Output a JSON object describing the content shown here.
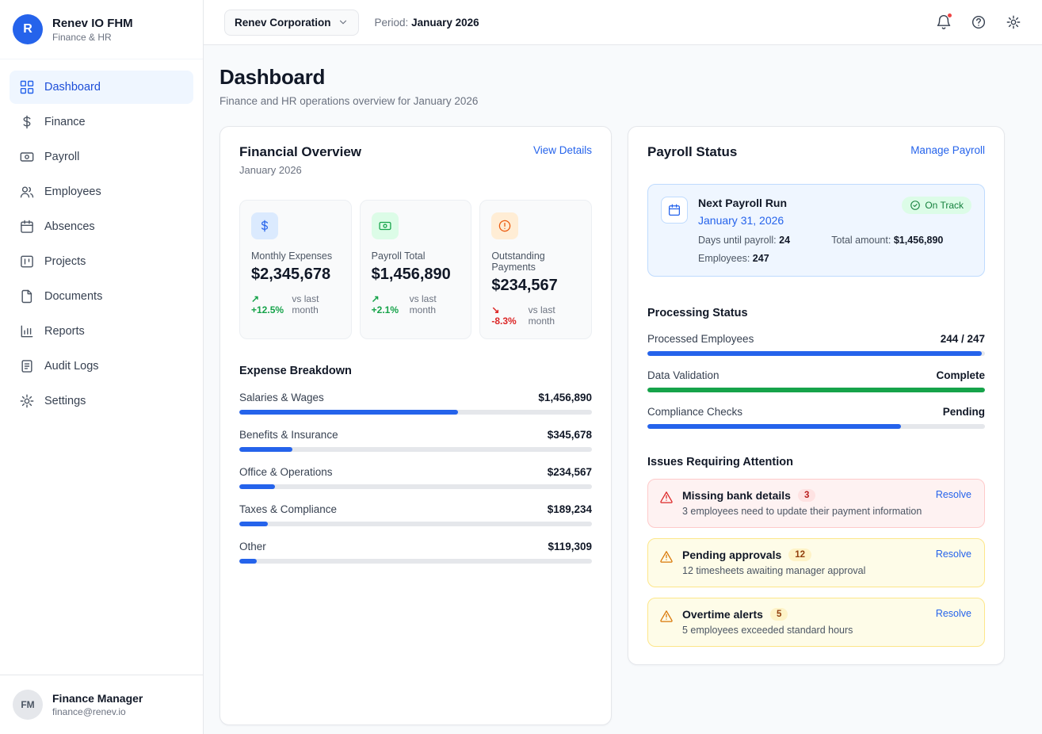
{
  "app": {
    "logo_letter": "R",
    "name": "Renev IO FHM",
    "subtitle": "Finance & HR"
  },
  "topbar": {
    "company": "Renev Corporation",
    "period_label": "Period:",
    "period_value": "January 2026"
  },
  "sidebar": {
    "items": [
      {
        "label": "Dashboard",
        "active": true
      },
      {
        "label": "Finance"
      },
      {
        "label": "Payroll"
      },
      {
        "label": "Employees"
      },
      {
        "label": "Absences"
      },
      {
        "label": "Projects"
      },
      {
        "label": "Documents"
      },
      {
        "label": "Reports"
      },
      {
        "label": "Audit Logs"
      },
      {
        "label": "Settings"
      }
    ],
    "user": {
      "initials": "FM",
      "name": "Finance Manager",
      "email": "finance@renev.io"
    }
  },
  "page": {
    "title": "Dashboard",
    "subtitle": "Finance and HR operations overview for January 2026"
  },
  "financial": {
    "title": "Financial Overview",
    "subtitle": "January 2026",
    "link": "View Details",
    "stats": [
      {
        "label": "Monthly Expenses",
        "value": "$2,345,678",
        "trend": "+12.5%",
        "trend_note": "vs last month",
        "trend_dir": "up"
      },
      {
        "label": "Payroll Total",
        "value": "$1,456,890",
        "trend": "+2.1%",
        "trend_note": "vs last month",
        "trend_dir": "up"
      },
      {
        "label": "Outstanding Payments",
        "value": "$234,567",
        "trend": "-8.3%",
        "trend_note": "vs last month",
        "trend_dir": "down"
      }
    ],
    "expense_breakdown": {
      "title": "Expense Breakdown",
      "items": [
        {
          "label": "Salaries & Wages",
          "value": "$1,456,890",
          "pct": "62%"
        },
        {
          "label": "Benefits & Insurance",
          "value": "$345,678",
          "pct": "15%"
        },
        {
          "label": "Office & Operations",
          "value": "$234,567",
          "pct": "10%"
        },
        {
          "label": "Taxes & Compliance",
          "value": "$189,234",
          "pct": "8%"
        },
        {
          "label": "Other",
          "value": "$119,309",
          "pct": "5%"
        }
      ]
    }
  },
  "payroll": {
    "title": "Payroll Status",
    "link": "Manage Payroll",
    "next_run": {
      "title": "Next Payroll Run",
      "date": "January 31, 2026",
      "badge": "On Track",
      "days_label": "Days until payroll:",
      "days_value": "24",
      "amount_label": "Total amount:",
      "amount_value": "$1,456,890",
      "employees_label": "Employees:",
      "employees_value": "247"
    },
    "processing": {
      "title": "Processing Status",
      "rows": [
        {
          "label": "Processed Employees",
          "value": "244 / 247",
          "pct": "99%",
          "color": "blue"
        },
        {
          "label": "Data Validation",
          "value": "Complete",
          "pct": "100%",
          "color": "green"
        },
        {
          "label": "Compliance Checks",
          "value": "Pending",
          "pct": "75%",
          "color": "blue"
        }
      ]
    },
    "issues": {
      "title": "Issues Requiring Attention",
      "items": [
        {
          "title": "Missing bank details",
          "count": "3",
          "desc": "3 employees need to update their payment information",
          "action": "Resolve",
          "severity": "error"
        },
        {
          "title": "Pending approvals",
          "count": "12",
          "desc": "12 timesheets awaiting manager approval",
          "action": "Resolve",
          "severity": "warning"
        },
        {
          "title": "Overtime alerts",
          "count": "5",
          "desc": "5 employees exceeded standard hours",
          "action": "Resolve",
          "severity": "warning"
        }
      ]
    }
  },
  "colors": {
    "primary": "#2563eb",
    "green": "#16a34a",
    "red": "#dc2626",
    "amber": "#d97706"
  }
}
